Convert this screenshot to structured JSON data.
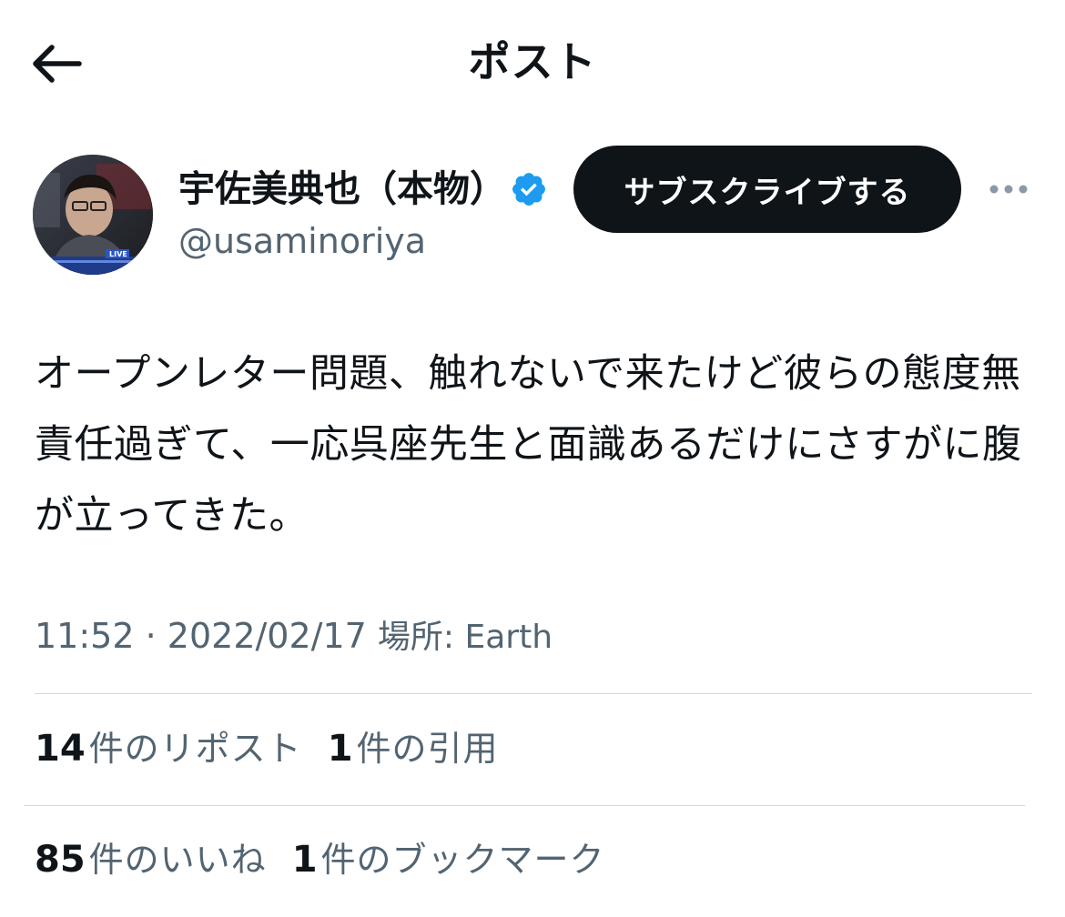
{
  "header": {
    "back_icon": "arrow-left-icon",
    "title": "ポスト"
  },
  "author": {
    "avatar_caption": "LIVE",
    "name": "宇佐美典也（本物）",
    "verified_icon": "verified-badge-icon",
    "verified_color": "#1d9bf0",
    "handle": "@usaminoriya",
    "subscribe_label": "サブスクライブする",
    "more_icon": "more-horizontal-icon"
  },
  "post": {
    "text": "オープンレター問題、触れないで来たけど彼らの態度無責任過ぎて、一応呉座先生と面識あるだけにさすがに腹が立ってきた。"
  },
  "meta": {
    "time": "11:52",
    "separator": "·",
    "date": "2022/02/17",
    "location": "場所: Earth"
  },
  "stats": {
    "reposts_count": "14",
    "reposts_label": "件のリポスト",
    "quotes_count": "1",
    "quotes_label": "件の引用",
    "likes_count": "85",
    "likes_label": "件のいいね",
    "bookmarks_count": "1",
    "bookmarks_label": "件のブックマーク"
  },
  "colors": {
    "text_primary": "#0f1419",
    "text_secondary": "#536471",
    "divider": "#cfd9de",
    "button_bg": "#0f1419"
  }
}
